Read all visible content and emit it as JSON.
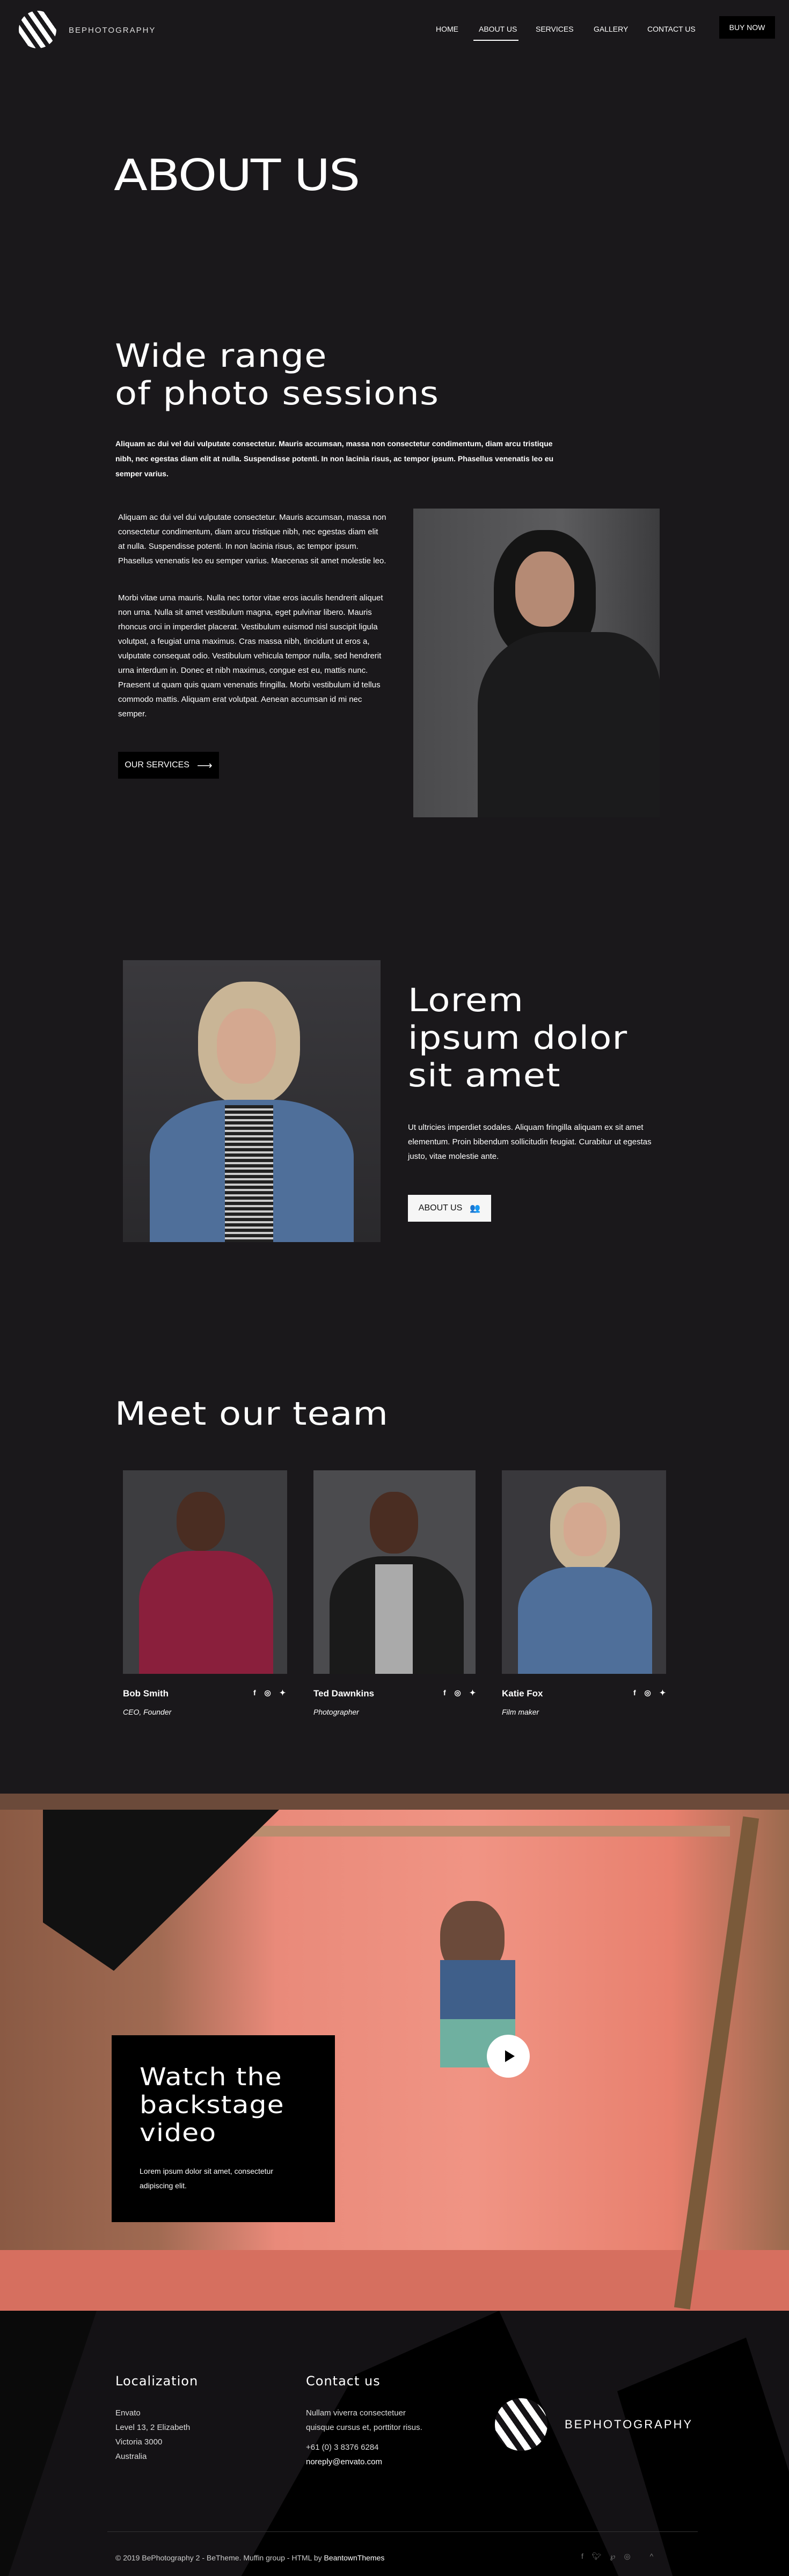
{
  "header": {
    "brand": "BEPHOTOGRAPHY",
    "nav": [
      "HOME",
      "ABOUT US",
      "SERVICES",
      "GALLERY",
      "CONTACT US"
    ],
    "active": "ABOUT US",
    "buy_now": "BUY NOW"
  },
  "page_title": "ABOUT US",
  "intro": {
    "heading_line1": "Wide range",
    "heading_line2": "of photo sessions",
    "lead": "Aliquam ac dui vel dui vulputate consectetur. Mauris accumsan, massa non consectetur condimentum, diam arcu tristique nibh, nec egestas diam elit at nulla. Suspendisse potenti. In non lacinia risus, ac tempor ipsum. Phasellus venenatis leo eu semper varius.",
    "p1": "Aliquam ac dui vel dui vulputate consectetur. Mauris accumsan, massa non consectetur condimentum, diam arcu tristique nibh, nec egestas diam elit at nulla. Suspendisse potenti. In non lacinia risus, ac tempor ipsum. Phasellus venenatis leo eu semper varius. Maecenas sit amet molestie leo.",
    "p2": "Morbi vitae urna mauris. Nulla nec tortor vitae eros iaculis hendrerit aliquet non urna. Nulla sit amet vestibulum magna, eget pulvinar libero. Mauris rhoncus orci in imperdiet placerat. Vestibulum euismod nisl suscipit ligula volutpat, a feugiat urna maximus. Cras massa nibh, tincidunt ut eros a, vulputate consequat odio. Vestibulum vehicula tempor nulla, sed hendrerit urna interdum in. Donec et nibh maximus, congue est eu, mattis nunc. Praesent ut quam quis quam venenatis fringilla. Morbi vestibulum id tellus commodo mattis. Aliquam erat volutpat. Aenean accumsan id mi nec semper.",
    "button": "OUR SERVICES"
  },
  "lorem": {
    "heading_line1": "Lorem",
    "heading_line2": "ipsum dolor",
    "heading_line3": "sit amet",
    "text": "Ut ultricies imperdiet sodales. Aliquam fringilla aliquam ex sit amet elementum. Proin bibendum sollicitudin feugiat. Curabitur ut egestas justo, vitae molestie ante.",
    "button": "ABOUT US"
  },
  "team": {
    "heading": "Meet our team",
    "members": [
      {
        "name": "Bob Smith",
        "role": "CEO, Founder"
      },
      {
        "name": "Ted Dawnkins",
        "role": "Photographer"
      },
      {
        "name": "Katie Fox",
        "role": "Film maker"
      }
    ],
    "social": "f ◎ ✦"
  },
  "video": {
    "line1": "Watch the",
    "line2": "backstage",
    "line3": "video",
    "text": "Lorem ipsum dolor sit amet, consectetur adipiscing elit."
  },
  "footer": {
    "localization": {
      "heading": "Localization",
      "lines": [
        "Envato",
        "Level 13, 2 Elizabeth",
        "Victoria 3000",
        "Australia"
      ]
    },
    "contact": {
      "heading": "Contact us",
      "line1": "Nullam viverra consectetuer",
      "line2": "quisque cursus et, porttitor risus.",
      "phone": "+61 (0) 3 8376 6284",
      "email": "noreply@envato.com"
    },
    "brand": "BEPHOTOGRAPHY",
    "copyright": "© 2019 BePhotography 2 - BeTheme. Muffin group - HTML by ",
    "copyright_link": "BeantownThemes"
  }
}
